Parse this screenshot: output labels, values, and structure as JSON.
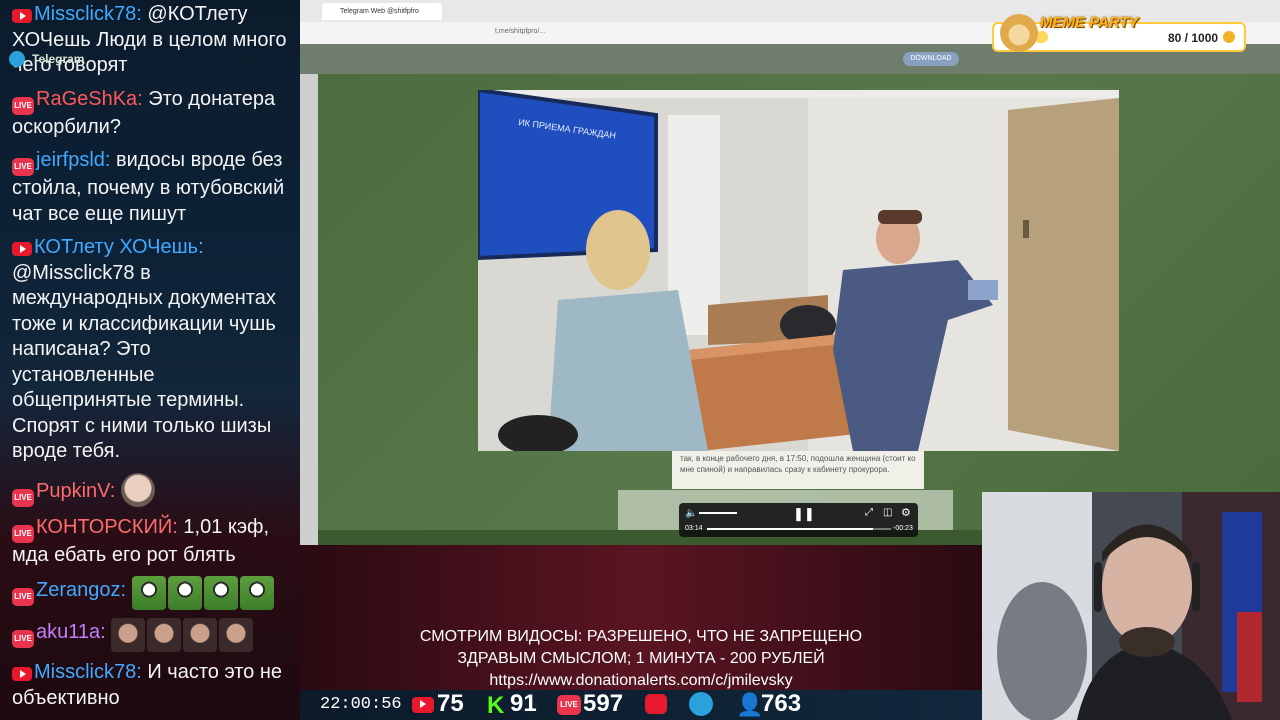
{
  "chat": {
    "messages": [
      {
        "nick": "Missclick78:",
        "nick_color": "#42a9ff",
        "platform": "youtube",
        "text": "@КОТлету ХОЧешь Люди в целом много чего говорят"
      },
      {
        "nick": "RaGeShKa:",
        "nick_color": "#ff5a5a",
        "platform": "live",
        "text": "Это донатера оскорбили?"
      },
      {
        "nick": "jeirfpsld:",
        "nick_color": "#42a9ff",
        "platform": "live",
        "text": "видосы вроде без стойла, почему в ютубовский чат все еще пишут"
      },
      {
        "nick": "КОТлету ХОЧешь:",
        "nick_color": "#42a9ff",
        "platform": "youtube",
        "text": "@Missclick78 в международных документах тоже и классификации чушь написана? Это установленные общепринятые термины. Спорят с ними только шизы вроде тебя."
      },
      {
        "nick": "PupkinV:",
        "nick_color": "#ff6b6b",
        "platform": "live",
        "text": ""
      },
      {
        "nick": "КОНТОРСКИЙ:",
        "nick_color": "#ff6b6b",
        "platform": "live",
        "text": "1,01 кэф, мда ебать его рот блять"
      },
      {
        "nick": "Zerangoz:",
        "nick_color": "#42a9ff",
        "platform": "live",
        "text": ""
      },
      {
        "nick": "aku11a:",
        "nick_color": "#c77dff",
        "platform": "live",
        "text": ""
      },
      {
        "nick": "Missclick78:",
        "nick_color": "#42a9ff",
        "platform": "youtube",
        "text": "И часто это не объективно"
      }
    ]
  },
  "browser": {
    "tab_title": "Telegram Web @shitfpfro",
    "url": "t.me/shitpfpro/...",
    "app_title": "Telegram",
    "download_label": "DOWNLOAD"
  },
  "video": {
    "time_elapsed": "03:14",
    "time_remaining": "-00:23",
    "progress": 0.9,
    "sign_text": "ИК ПРИЕМА ГРАЖДАН"
  },
  "message_text": "так, в конце рабочего дня, в 17:50, подошла женщина (стоит ко мне спиной) и направилась сразу к кабинету прокурора.",
  "band": {
    "line1": "СМОТРИМ ВИДОСЫ: РАЗРЕШЕНО, ЧТО НЕ ЗАПРЕЩЕНО",
    "line2": "ЗДРАВЫМ СМЫСЛОМ; 1 МИНУТА - 200 РУБЛЕЙ",
    "line3": "https://www.donationalerts.com/c/jmilevsky"
  },
  "status": {
    "clock": "22:00:56",
    "youtube_viewers": "75",
    "kick_viewers": "91",
    "live_viewers": "597",
    "total_viewers": "763"
  },
  "meme_party": {
    "title": "MEME PARTY",
    "count": "80 / 1000",
    "progress": 0.08
  }
}
